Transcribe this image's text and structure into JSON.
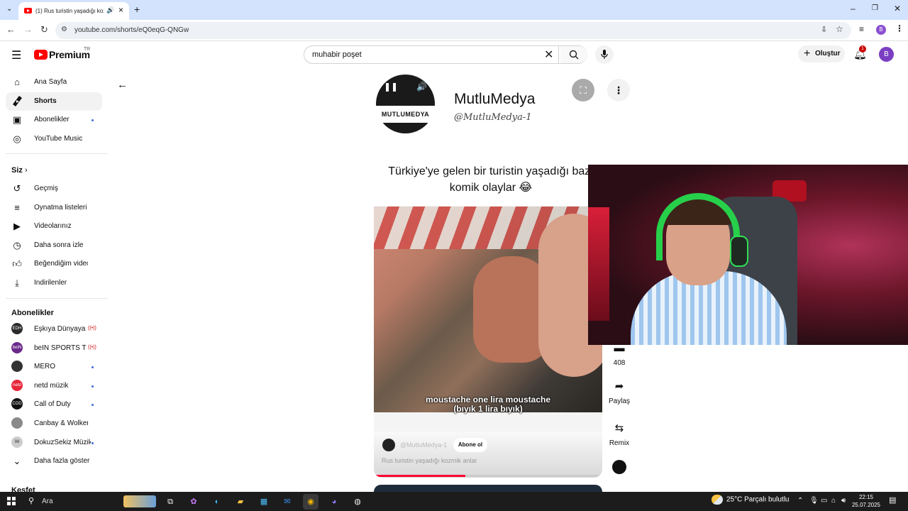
{
  "browser": {
    "tab_title": "(1) Rus turistin yaşadığı kozmik anlar",
    "url": "youtube.com/shorts/eQ0eqG-QNGw",
    "profile_initial": "B"
  },
  "header": {
    "logo_text": "Premium",
    "logo_region": "TR",
    "search_value": "muhabir poşet",
    "create_label": "Oluştur",
    "notification_count": "1",
    "avatar_initial": "B"
  },
  "sidebar": {
    "main": [
      {
        "label": "Ana Sayfa",
        "icon": "home-icon"
      },
      {
        "label": "Shorts",
        "icon": "shorts-icon",
        "active": true
      },
      {
        "label": "Abonelikler",
        "icon": "subscriptions-icon",
        "dot": true
      },
      {
        "label": "YouTube Music",
        "icon": "music-icon"
      }
    ],
    "you_header": "Siz",
    "you": [
      {
        "label": "Geçmiş",
        "icon": "history-icon"
      },
      {
        "label": "Oynatma listeleri",
        "icon": "playlist-icon"
      },
      {
        "label": "Videolarınız",
        "icon": "your-videos-icon"
      },
      {
        "label": "Daha sonra izle",
        "icon": "watch-later-icon"
      },
      {
        "label": "Beğendiğim videolar",
        "icon": "liked-icon"
      },
      {
        "label": "İndirilenler",
        "icon": "download-icon"
      }
    ],
    "subs_header": "Abonelikler",
    "subs": [
      {
        "label": "Eşkıya Dünyaya ...",
        "avatar_color": "#2a2a2a",
        "avatar_text": "EDH",
        "live": true
      },
      {
        "label": "beIN SPORTS Tü...",
        "avatar_color": "#6a2a8a",
        "avatar_text": "beIN",
        "live": true
      },
      {
        "label": "MERO",
        "avatar_color": "#333333",
        "avatar_text": "",
        "dot": true
      },
      {
        "label": "netd müzik",
        "avatar_color": "#e8263a",
        "avatar_text": "netd",
        "dot": true
      },
      {
        "label": "Call of Duty",
        "avatar_color": "#111111",
        "avatar_text": "COD",
        "dot": true
      },
      {
        "label": "Canbay & Wolker",
        "avatar_color": "#8a8a8a",
        "avatar_text": "",
        "dot": false
      },
      {
        "label": "DokuzSekiz Müzik",
        "avatar_color": "#cccccc",
        "avatar_text": "98",
        "dot": true
      },
      {
        "label": "Daha fazla göster",
        "avatar_color": "",
        "avatar_text": "",
        "more": true
      }
    ],
    "explore_header": "Keşfet"
  },
  "short": {
    "channel_logo_text": "MUTLUMEDYA",
    "channel_name": "MutluMedya",
    "channel_handle": "@MutluMedya-1",
    "caption": "Türkiye'ye gelen bir turistin yaşadığı bazı komik olaylar 😂",
    "subtitle_line1": "moustache one lira moustache",
    "subtitle_line2": "(bıyık 1 lira bıyık)",
    "bottom_handle": "@MutluMedya-1",
    "subscribe_label": "Abone ol",
    "video_title": "Rus turistin yaşadığı kozmik anlar",
    "progress": 0.4
  },
  "actions": {
    "comments_count": "408",
    "share_label": "Paylaş",
    "remix_label": "Remix"
  },
  "taskbar": {
    "search_label": "Ara",
    "weather": "25°C  Parçalı bulutlu",
    "time": "22:15",
    "date": "25.07.2025"
  }
}
